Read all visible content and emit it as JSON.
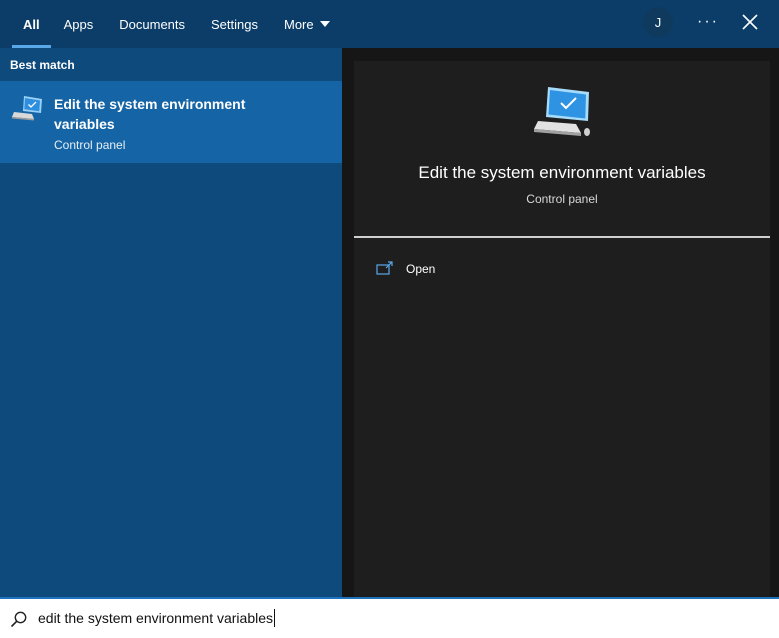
{
  "tabs": [
    {
      "label": "All"
    },
    {
      "label": "Apps"
    },
    {
      "label": "Documents"
    },
    {
      "label": "Settings"
    },
    {
      "label": "More"
    }
  ],
  "account": {
    "initial": "J"
  },
  "options_label": "···",
  "best_match": {
    "heading": "Best match",
    "title": "Edit the system environment variables",
    "subtitle": "Control panel"
  },
  "preview": {
    "title": "Edit the system environment variables",
    "subtitle": "Control panel",
    "actions": [
      {
        "label": "Open",
        "icon": "open-external-icon"
      }
    ]
  },
  "search": {
    "query": "edit the system environment variables"
  },
  "colors": {
    "accent": "#5aa7e8",
    "topbar": "#0b3d68",
    "left_pane": "#0f4a7c",
    "selected_item": "#1565a6",
    "right_pane": "#1e1e1e"
  },
  "icons": {
    "result": "computer-monitor-icon",
    "close": "close-icon",
    "search": "search-icon"
  }
}
